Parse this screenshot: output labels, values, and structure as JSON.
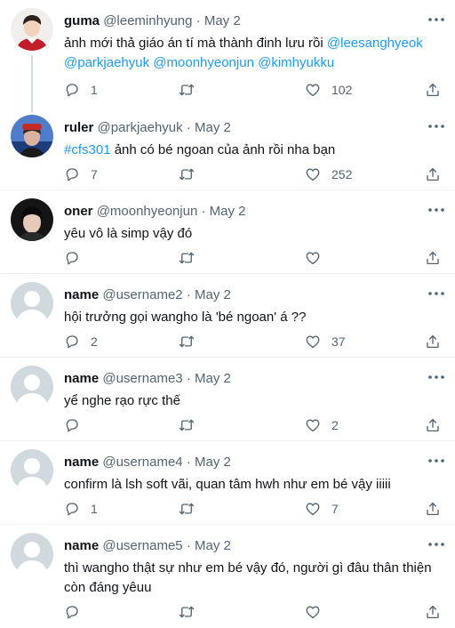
{
  "tweets": [
    {
      "name": "guma",
      "handle": "@leeminhyung",
      "dot": "·",
      "date": "May 2",
      "text_plain": "ảnh mới thả giáo án tí mà thành đinh lưu rồi ",
      "mention1": "@leesanghyeok",
      "mention2": "@parkjaehyuk",
      "mention3": "@moonhyeonjun",
      "mention4": "@kimhyukku",
      "replies": "1",
      "retweets": "",
      "likes": "102"
    },
    {
      "name": "ruler",
      "handle": "@parkjaehyuk",
      "dot": "·",
      "date": "May 2",
      "hashtag": "#cfs301",
      "text_plain": " ảnh có bé ngoan của ảnh rồi nha bạn",
      "replies": "7",
      "retweets": "",
      "likes": "252"
    },
    {
      "name": "oner",
      "handle": "@moonhyeonjun",
      "dot": "·",
      "date": "May 2",
      "text_plain": "yêu vô là simp vậy đó",
      "replies": "",
      "retweets": "",
      "likes": ""
    },
    {
      "name": "name",
      "handle": "@username2",
      "dot": "·",
      "date": "May 2",
      "text_plain": "hội trưởng gọi wangho là 'bé ngoan' á ??",
      "replies": "2",
      "retweets": "",
      "likes": "37"
    },
    {
      "name": "name",
      "handle": "@username3",
      "dot": "·",
      "date": "May 2",
      "text_plain": "yể nghe rạo rực thế",
      "replies": "",
      "retweets": "",
      "likes": "2"
    },
    {
      "name": "name",
      "handle": "@username4",
      "dot": "·",
      "date": "May 2",
      "text_plain": "confirm là lsh soft vãi, quan tâm hwh như em bé vậy iiiii",
      "replies": "1",
      "retweets": "",
      "likes": "7"
    },
    {
      "name": "name",
      "handle": "@username5",
      "dot": "·",
      "date": "May 2",
      "text_line1": "thì wangho thật sự như em bé vậy đó, người gì đâu thân thiện",
      "text_line2": "còn đáng yêuu",
      "replies": "",
      "retweets": "",
      "likes": ""
    }
  ],
  "icons": {
    "reply": "reply-icon",
    "retweet": "retweet-icon",
    "like": "heart-icon",
    "share": "share-icon",
    "more": "more-icon"
  },
  "colors": {
    "link": "#1d9bf0",
    "secondary": "#536471",
    "thread_line": "#cfd9de",
    "separator": "#eff3f4"
  }
}
